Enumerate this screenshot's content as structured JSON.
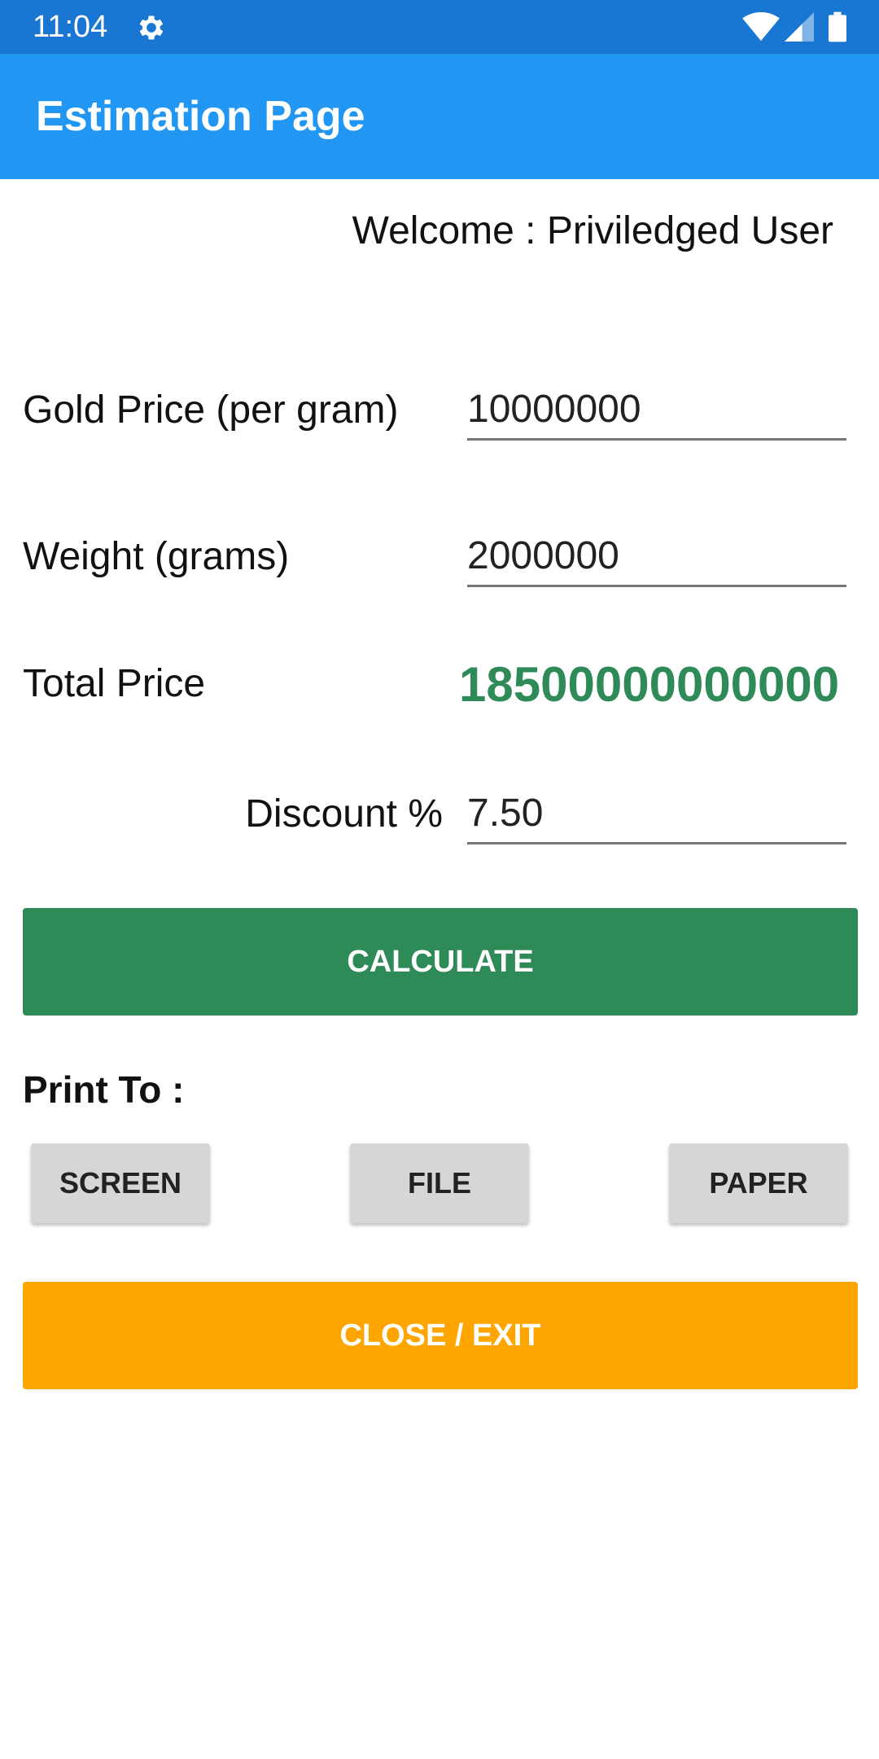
{
  "status_bar": {
    "time": "11:04",
    "icons": [
      "gear-icon",
      "wifi-icon",
      "signal-icon",
      "battery-icon"
    ]
  },
  "app_bar": {
    "title": "Estimation Page",
    "color": "#2196f3"
  },
  "welcome_text": "Welcome : Priviledged User",
  "form": {
    "gold_price": {
      "label": "Gold Price (per gram)",
      "value": "10000000"
    },
    "weight": {
      "label": "Weight (grams)",
      "value": "2000000"
    },
    "total_price": {
      "label": "Total Price",
      "value": "18500000000000"
    },
    "discount": {
      "label": "Discount %",
      "value": "7.50"
    }
  },
  "buttons": {
    "calculate": "CALCULATE",
    "print_to_label": "Print To :",
    "screen": "SCREEN",
    "file": "FILE",
    "paper": "PAPER",
    "close_exit": "CLOSE / EXIT"
  },
  "colors": {
    "status_bar": "#1976d2",
    "calculate": "#2e8b57",
    "total_price": "#2e8b57",
    "close_exit": "#ffa500",
    "print_buttons": "#d6d6d6"
  }
}
